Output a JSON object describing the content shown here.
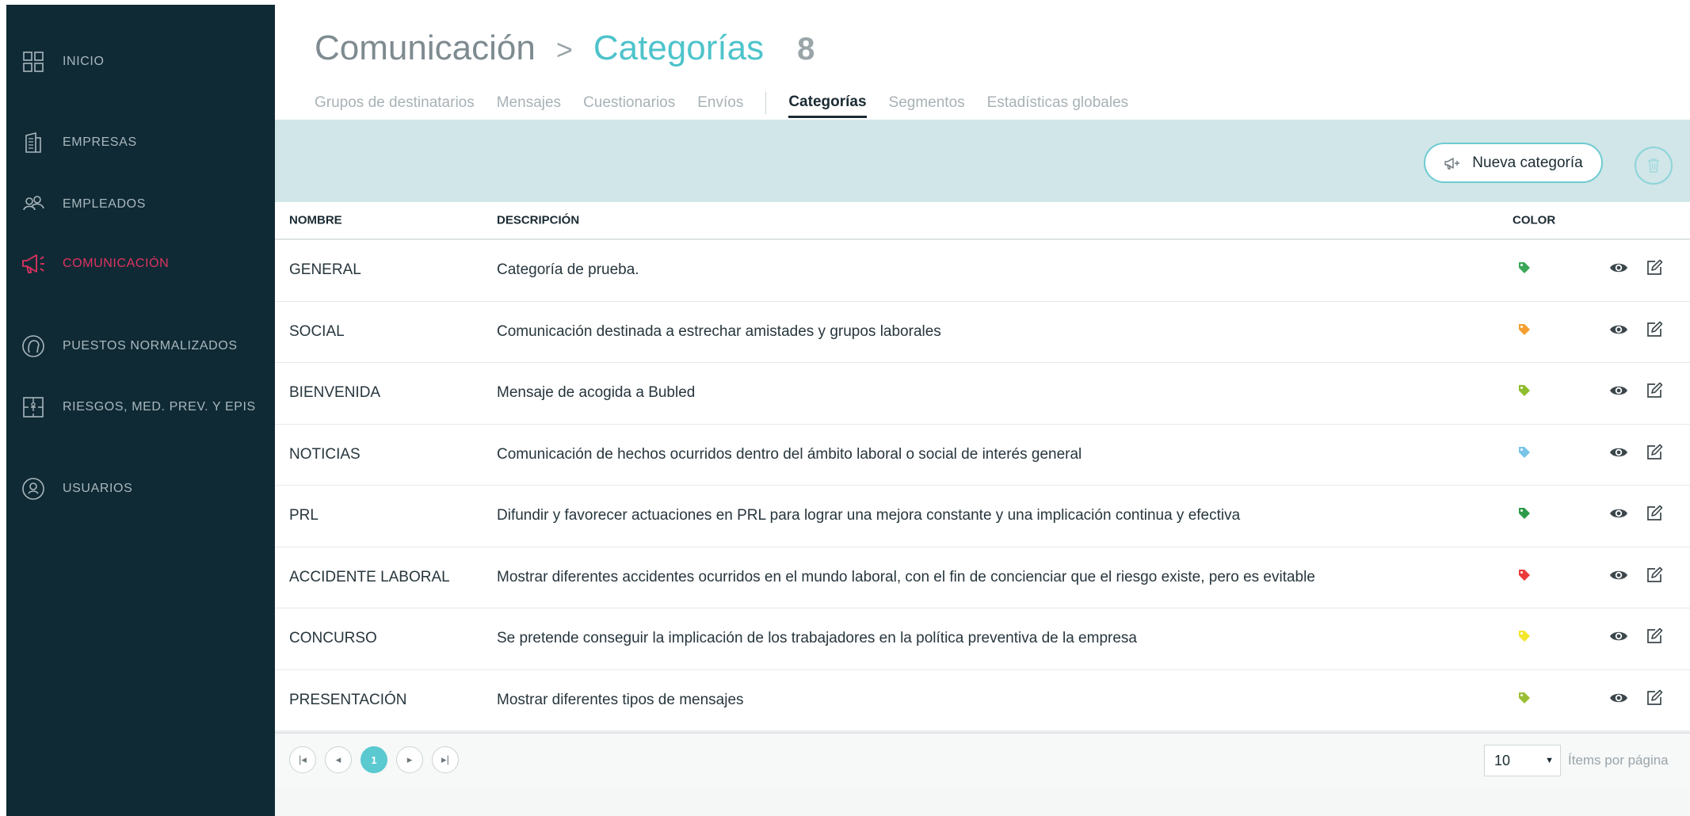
{
  "sidebar": {
    "items": [
      {
        "label": "INICIO",
        "icon": "grid-icon",
        "active": false
      },
      {
        "label": "EMPRESAS",
        "icon": "building-icon",
        "active": false
      },
      {
        "label": "EMPLEADOS",
        "icon": "people-icon",
        "active": false
      },
      {
        "label": "COMUNICACIÓN",
        "icon": "megaphone-icon",
        "active": true
      },
      {
        "label": "PUESTOS NORMALIZADOS",
        "icon": "head-icon",
        "active": false
      },
      {
        "label": "RIESGOS, MED. PREV. Y EPIS",
        "icon": "puzzle-icon",
        "active": false
      },
      {
        "label": "USUARIOS",
        "icon": "user-circle-icon",
        "active": false
      }
    ],
    "active_color": "#e0325f"
  },
  "header": {
    "breadcrumb_parent": "Comunicación",
    "breadcrumb_separator": ">",
    "breadcrumb_current": "Categorías",
    "count": "8",
    "tabs_group1": [
      "Grupos de destinatarios",
      "Mensajes",
      "Cuestionarios",
      "Envíos"
    ],
    "tabs_group2": [
      "Categorías",
      "Segmentos",
      "Estadísticas globales"
    ],
    "active_tab": "Categorías"
  },
  "toolbar": {
    "new_label": "Nueva categoría",
    "new_icon": "megaphone-plus-icon",
    "delete_icon": "trash-icon"
  },
  "table": {
    "columns": [
      "NOMBRE",
      "DESCRIPCIÓN",
      "COLOR"
    ],
    "rows": [
      {
        "name": "GENERAL",
        "description": "Categoría de prueba.",
        "color": "#3aa657"
      },
      {
        "name": "SOCIAL",
        "description": "Comunicación destinada a estrechar amistades y grupos laborales",
        "color": "#f5a031"
      },
      {
        "name": "BIENVENIDA",
        "description": "Mensaje de acogida a Bubled",
        "color": "#8ebd2d"
      },
      {
        "name": "NOTICIAS",
        "description": "Comunicación de hechos ocurridos dentro del ámbito laboral o social de interés general",
        "color": "#79c4e8"
      },
      {
        "name": "PRL",
        "description": "Difundir y favorecer actuaciones en PRL para lograr una mejora constante y una implicación continua y efectiva",
        "color": "#2e9a4a"
      },
      {
        "name": "ACCIDENTE LABORAL",
        "description": "Mostrar diferentes accidentes ocurridos en el mundo laboral, con el fin de concienciar que el riesgo existe, pero es evitable",
        "color": "#ec3a3a"
      },
      {
        "name": "CONCURSO",
        "description": "Se pretende conseguir la implicación de los trabajadores en la política preventiva de la empresa",
        "color": "#f3e62b"
      },
      {
        "name": "PRESENTACIÓN",
        "description": "Mostrar diferentes tipos de mensajes",
        "color": "#9bbf34"
      }
    ],
    "row_actions": [
      "eye-icon",
      "edit-icon"
    ]
  },
  "footer": {
    "current_page": "1",
    "per_page_value": "10",
    "per_page_label": "Ítems por página"
  }
}
